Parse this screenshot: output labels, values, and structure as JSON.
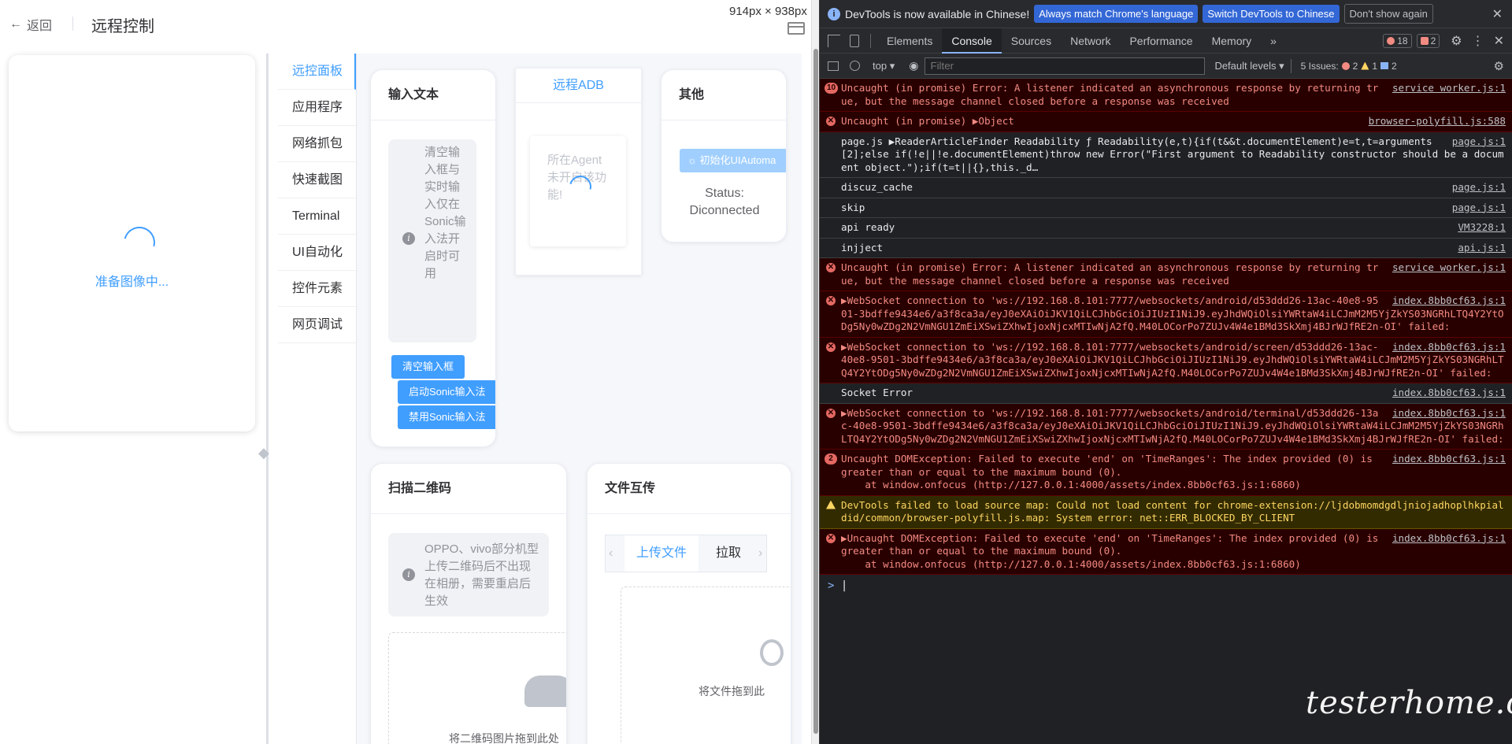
{
  "app": {
    "back_label": "返回",
    "title": "远程控制",
    "viewport_size": "914px × 938px",
    "phone": {
      "loading_text": "准备图像中..."
    },
    "nav": [
      "远控面板",
      "应用程序",
      "网络抓包",
      "快速截图",
      "Terminal",
      "UI自动化",
      "控件元素",
      "网页调试"
    ],
    "input_card": {
      "title": "输入文本",
      "tip": "清空输入框与实时输入仅在Sonic输入法开启时可用",
      "clear_btn": "清空输入框",
      "enable_btn": "启动Sonic输入法",
      "disable_btn": "禁用Sonic输入法"
    },
    "adb_card": {
      "tab": "远程ADB",
      "placeholder": "所在Agent未开启该功能!"
    },
    "other_card": {
      "title": "其他",
      "init_btn": "初始化UIAutoma",
      "status": "Status: Diconnected"
    },
    "qr_card": {
      "title": "扫描二维码",
      "tip": "OPPO、vivo部分机型上传二维码后不出现在相册，需要重启后生效",
      "drop_text": "将二维码图片拖到此处"
    },
    "file_card": {
      "title": "文件互传",
      "tab_upload": "上传文件",
      "tab_pull": "拉取",
      "drop_text": "将文件拖到此"
    }
  },
  "devtools": {
    "infobar": {
      "text": "DevTools is now available in Chinese!",
      "btn1": "Always match Chrome's language",
      "btn2": "Switch DevTools to Chinese",
      "btn3": "Don't show again"
    },
    "tabs": [
      "Elements",
      "Console",
      "Sources",
      "Network",
      "Performance",
      "Memory"
    ],
    "more": "»",
    "error_count": "18",
    "warn_count": "2",
    "context": "top",
    "filter_placeholder": "Filter",
    "levels": "Default levels",
    "issues": {
      "label": "5 Issues:",
      "errors": "2",
      "warnings": "1",
      "info": "2"
    },
    "messages": [
      {
        "type": "err",
        "count": "10",
        "src": "service worker.js:1",
        "text": "Uncaught (in promise) Error: A listener indicated an asynchronous response by returning true, but the message channel closed before a response was received"
      },
      {
        "type": "err",
        "src": "browser-polyfill.js:588",
        "text": "Uncaught (in promise) ▶Object"
      },
      {
        "type": "log",
        "src": "page.js:1",
        "text": "page.js ▶ReaderArticleFinder Readability ƒ Readability(e,t){if(t&&t.documentElement)e=t,t=arguments[2];else if(!e||!e.documentElement)throw new Error(\"First argument to Readability constructor should be a document object.\");if(t=t||{},this._d…"
      },
      {
        "type": "log",
        "src": "page.js:1",
        "text": "discuz_cache"
      },
      {
        "type": "log",
        "src": "page.js:1",
        "text": "skip"
      },
      {
        "type": "log",
        "src": "VM3228:1",
        "text": "api ready"
      },
      {
        "type": "log",
        "src": "api.js:1",
        "text": "injject"
      },
      {
        "type": "err",
        "src": "service worker.js:1",
        "text": "Uncaught (in promise) Error: A listener indicated an asynchronous response by returning true, but the message channel closed before a response was received"
      },
      {
        "type": "err",
        "src": "index.8bb0cf63.js:1",
        "text": "▶WebSocket connection to 'ws://192.168.8.101:7777/websockets/android/d53ddd26-13ac-40e8-9501-3bdffe9434e6/a3f8ca3a/eyJ0eXAiOiJKV1QiLCJhbGciOiJIUzI1NiJ9.eyJhdWQiOlsiYWRtaW4iLCJmM2M5YjZkYS03NGRhLTQ4Y2YtODg5Ny0wZDg2N2VmNGU1ZmEiXSwiZXhwIjoxNjcxMTIwNjA2fQ.M40LOCorPo7ZUJv4W4e1BMd3SkXmj4BJrWJfRE2n-OI' failed:"
      },
      {
        "type": "err",
        "src": "index.8bb0cf63.js:1",
        "text": "▶WebSocket connection to 'ws://192.168.8.101:7777/websockets/android/screen/d53ddd26-13ac-40e8-9501-3bdffe9434e6/a3f8ca3a/eyJ0eXAiOiJKV1QiLCJhbGciOiJIUzI1NiJ9.eyJhdWQiOlsiYWRtaW4iLCJmM2M5YjZkYS03NGRhLTQ4Y2YtODg5Ny0wZDg2N2VmNGU1ZmEiXSwiZXhwIjoxNjcxMTIwNjA2fQ.M40LOCorPo7ZUJv4W4e1BMd3SkXmj4BJrWJfRE2n-OI' failed:"
      },
      {
        "type": "log",
        "src": "index.8bb0cf63.js:1",
        "text": "Socket Error"
      },
      {
        "type": "err",
        "src": "index.8bb0cf63.js:1",
        "text": "▶WebSocket connection to 'ws://192.168.8.101:7777/websockets/android/terminal/d53ddd26-13ac-40e8-9501-3bdffe9434e6/a3f8ca3a/eyJ0eXAiOiJKV1QiLCJhbGciOiJIUzI1NiJ9.eyJhdWQiOlsiYWRtaW4iLCJmM2M5YjZkYS03NGRhLTQ4Y2YtODg5Ny0wZDg2N2VmNGU1ZmEiXSwiZXhwIjoxNjcxMTIwNjA2fQ.M40LOCorPo7ZUJv4W4e1BMd3SkXmj4BJrWJfRE2n-OI' failed:"
      },
      {
        "type": "err",
        "count": "2",
        "src": "index.8bb0cf63.js:1",
        "text": "Uncaught DOMException: Failed to execute 'end' on 'TimeRanges': The index provided (0) is greater than or equal to the maximum bound (0).\n    at window.onfocus (http://127.0.0.1:4000/assets/index.8bb0cf63.js:1:6860)"
      },
      {
        "type": "warn",
        "src": "",
        "text": "DevTools failed to load source map: Could not load content for chrome-extension://ljdobmomdgdljniojadhoplhkpialdid/common/browser-polyfill.js.map: System error: net::ERR_BLOCKED_BY_CLIENT"
      },
      {
        "type": "err",
        "src": "index.8bb0cf63.js:1",
        "text": "▶Uncaught DOMException: Failed to execute 'end' on 'TimeRanges': The index provided (0) is greater than or equal to the maximum bound (0).\n    at window.onfocus (http://127.0.0.1:4000/assets/index.8bb0cf63.js:1:6860)"
      }
    ],
    "prompt": ">"
  },
  "watermark": "testerhome.com"
}
